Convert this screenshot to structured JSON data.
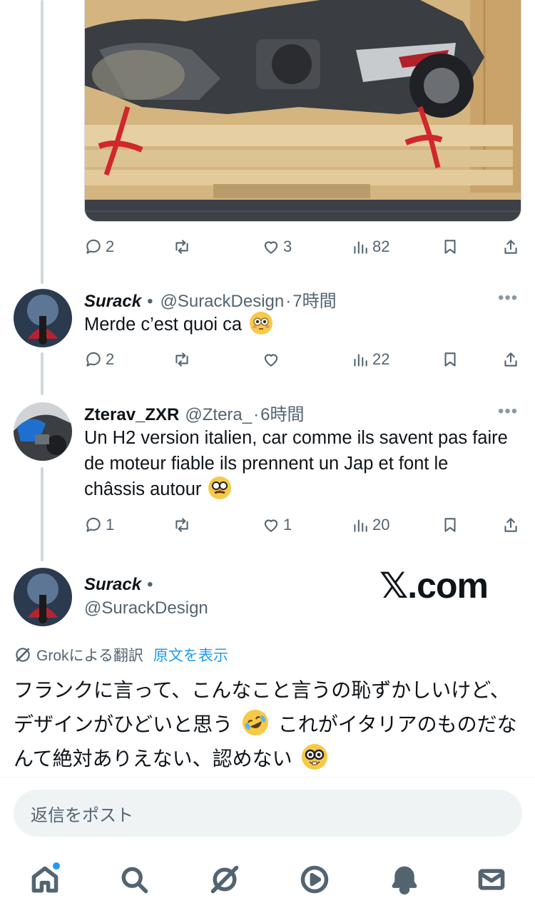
{
  "media_post": {
    "actions": {
      "replies": "2",
      "reposts": "",
      "likes": "3",
      "views": "82"
    }
  },
  "replies": [
    {
      "name": "Surack",
      "bullet": "•",
      "handle": "@SurackDesign",
      "time_sep": "·",
      "time": "7時間",
      "text": "Merde c’est quoi ca",
      "emoji": "flushed-face",
      "actions": {
        "replies": "2",
        "reposts": "",
        "likes": "",
        "views": "22"
      }
    },
    {
      "name": "Zterav_ZXR",
      "handle": "@Ztera_",
      "time_sep": "·",
      "time": "6時間",
      "text": "Un H2 version italien, car comme ils savent pas faire de moteur fiable ils prennent un Jap et font le châssis autour",
      "emoji": "disguised-face",
      "actions": {
        "replies": "1",
        "reposts": "",
        "likes": "1",
        "views": "20"
      }
    }
  ],
  "main_post": {
    "name": "Surack",
    "bullet": "•",
    "handle": "@SurackDesign",
    "watermark": "𝕏.com",
    "grok_label": "Grokによる翻訳",
    "show_original": "原文を表示",
    "text_part1": "フランクに言って、こんなこと言うの恥ずかしいけど、デザインがひどいと思う",
    "emoji1": "rolling-on-floor-laughing",
    "text_part2": "これがイタリアのものだなんて絶対ありえない、認めない",
    "emoji2": "nerd-face"
  },
  "composer": {
    "placeholder": "返信をポスト"
  },
  "bottom_nav": {
    "items": [
      "home-icon",
      "search-icon",
      "grok-icon",
      "video-icon",
      "notifications-icon",
      "messages-icon"
    ],
    "home_has_badge": true
  },
  "colors": {
    "accent": "#1d9bf0",
    "muted": "#536471",
    "text": "#0f1419",
    "line": "#cfd9de"
  }
}
